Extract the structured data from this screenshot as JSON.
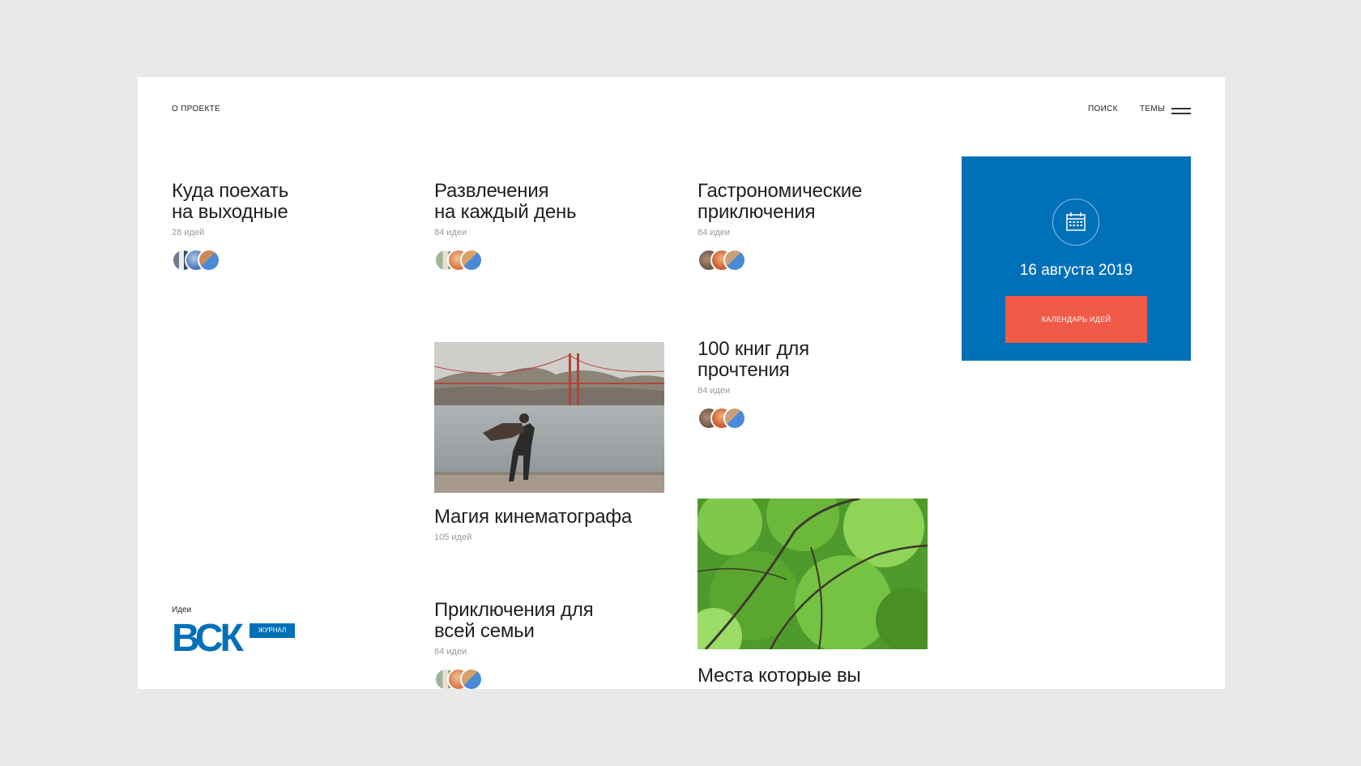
{
  "header": {
    "about": "О ПРОЕКТЕ",
    "search": "ПОИСК",
    "themes": "ТЕМЫ",
    "menu_icon": "hamburger-icon"
  },
  "cards": [
    {
      "title_line1": "Куда поехать",
      "title_line2": "на выходные",
      "count": "28 идей"
    },
    {
      "title_line1": "Развлечения",
      "title_line2": "на каждый день",
      "count": "84 идеи"
    },
    {
      "title_line1": "Гастрономические",
      "title_line2": "приключения",
      "count": "84 идеи"
    },
    {
      "title_line1": "100 книг для",
      "title_line2": "прочтения",
      "count": "84 идеи"
    },
    {
      "title_line1": "Магия кинематографа",
      "count": "105 идей"
    },
    {
      "title_line1": "Приключения для",
      "title_line2": "всей семьи",
      "count": "84 идеи"
    },
    {
      "title_line1": "Места которые вы"
    }
  ],
  "calendar": {
    "icon": "calendar-icon",
    "date": "16 августа 2019",
    "button": "КАЛЕНДАРЬ ИДЕЙ"
  },
  "logo": {
    "caption": "Идеи",
    "brand": "ВСК",
    "badge": "ЖУРНАЛ"
  },
  "colors": {
    "page_bg": "#e9e9e9",
    "card_bg": "#ffffff",
    "brand_blue": "#0070b9",
    "accent_red": "#f25a48"
  }
}
